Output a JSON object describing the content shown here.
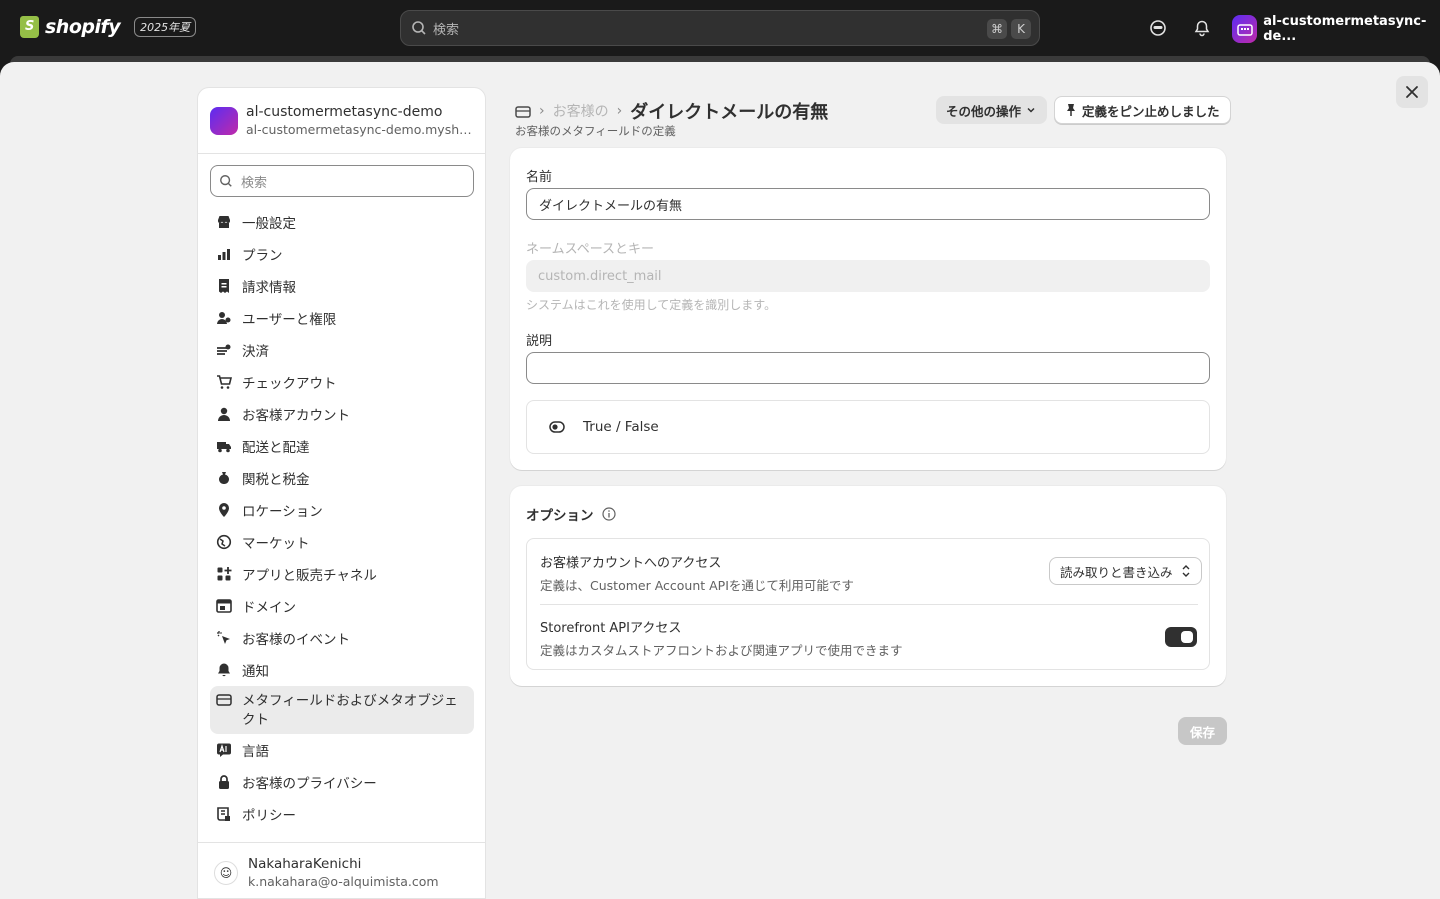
{
  "topbar": {
    "logo_text": "shopify",
    "edition": "2025年夏",
    "search_placeholder": "検索",
    "kbd_cmd": "⌘",
    "kbd_k": "K",
    "store_name": "al-customermetasync-de..."
  },
  "sidebar": {
    "store_name": "al-customermetasync-demo",
    "store_url": "al-customermetasync-demo.myshopify.com",
    "search_placeholder": "検索",
    "items": [
      {
        "label": "一般設定",
        "icon": "store-icon"
      },
      {
        "label": "プラン",
        "icon": "plan-icon"
      },
      {
        "label": "請求情報",
        "icon": "receipt-icon"
      },
      {
        "label": "ユーザーと権限",
        "icon": "users-icon"
      },
      {
        "label": "決済",
        "icon": "payment-icon"
      },
      {
        "label": "チェックアウト",
        "icon": "cart-icon"
      },
      {
        "label": "お客様アカウント",
        "icon": "person-icon"
      },
      {
        "label": "配送と配達",
        "icon": "truck-icon"
      },
      {
        "label": "関税と税金",
        "icon": "money-bag-icon"
      },
      {
        "label": "ロケーション",
        "icon": "location-icon"
      },
      {
        "label": "マーケット",
        "icon": "globe-icon"
      },
      {
        "label": "アプリと販売チャネル",
        "icon": "apps-icon"
      },
      {
        "label": "ドメイン",
        "icon": "domain-icon"
      },
      {
        "label": "お客様のイベント",
        "icon": "cursor-icon"
      },
      {
        "label": "通知",
        "icon": "bell-icon"
      },
      {
        "label": "メタフィールドおよびメタオブジェクト",
        "icon": "metafield-icon",
        "active": true
      },
      {
        "label": "言語",
        "icon": "language-icon"
      },
      {
        "label": "お客様のプライバシー",
        "icon": "lock-icon"
      },
      {
        "label": "ポリシー",
        "icon": "policy-icon"
      }
    ],
    "user": {
      "name": "NakaharaKenichi",
      "email": "k.nakahara@o-alquimista.com"
    }
  },
  "header": {
    "breadcrumb_parent": "お客様の",
    "title": "ダイレクトメールの有無",
    "subtitle": "お客様のメタフィールドの定義",
    "more_actions": "その他の操作",
    "pin_label": "定義をピン止めしました"
  },
  "form": {
    "name_label": "名前",
    "name_value": "ダイレクトメールの有無",
    "namespace_label": "ネームスペースとキー",
    "namespace_value": "custom.direct_mail",
    "namespace_help": "システムはこれを使用して定義を識別します。",
    "description_label": "説明",
    "description_value": "",
    "type_label": "True / False"
  },
  "options": {
    "title": "オプション",
    "customer_access_title": "お客様アカウントへのアクセス",
    "customer_access_desc": "定義は、Customer Account APIを通じて利用可能です",
    "customer_access_value": "読み取りと書き込み",
    "storefront_title": "Storefront APIアクセス",
    "storefront_desc": "定義はカスタムストアフロントおよび関連アプリで使用できます",
    "storefront_enabled": true
  },
  "save_label": "保存",
  "colors": {
    "accent": "#303030",
    "topbar": "#1a1a1a",
    "modal_bg": "#f1f1f1"
  }
}
